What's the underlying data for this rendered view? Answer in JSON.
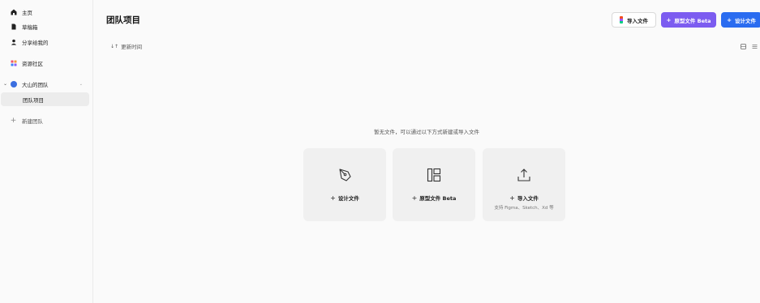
{
  "sidebar": {
    "items": [
      {
        "label": "主页",
        "icon": "home-icon"
      },
      {
        "label": "草稿箱",
        "icon": "file-icon"
      },
      {
        "label": "分享给我的",
        "icon": "user-icon"
      },
      {
        "label": "资源社区",
        "icon": "grid-icon"
      },
      {
        "label": "大山的团队",
        "icon": "team-avatar-icon"
      },
      {
        "label": "团队项目"
      },
      {
        "label": "新建团队",
        "icon": "plus-icon"
      }
    ]
  },
  "header": {
    "title": "团队项目",
    "import_label": "导入文件",
    "proto_label": "原型文件 Beta",
    "design_label": "设计文件"
  },
  "toolbar": {
    "sort_label": "更新时间"
  },
  "empty": {
    "message": "暂无文件，可以通过以下方式新建或导入文件"
  },
  "cards": [
    {
      "label": "设计文件",
      "icon": "pen-tool-icon"
    },
    {
      "label": "原型文件 Beta",
      "icon": "layout-icon"
    },
    {
      "label": "导入文件",
      "icon": "upload-icon",
      "sub": "支持 Figma、Sketch、Xd 等"
    }
  ],
  "colors": {
    "primary": "#2a6cf0",
    "proto": "#7c5cf0",
    "team": "#3b6fe0"
  }
}
